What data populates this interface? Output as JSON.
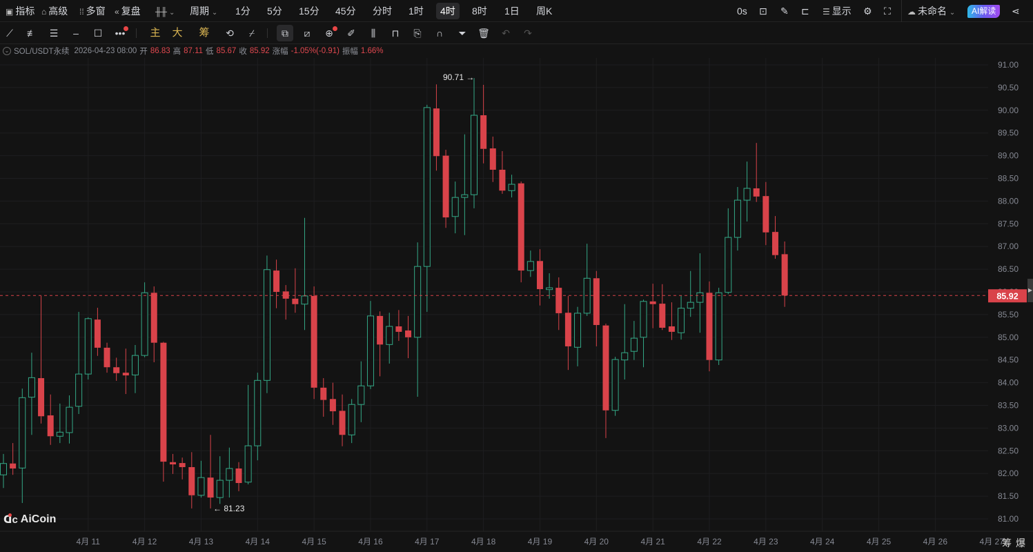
{
  "topbar": {
    "left": [
      {
        "label": "指标",
        "icon": "chart-box-icon"
      },
      {
        "label": "高级",
        "icon": "folder-icon"
      },
      {
        "label": "多窗",
        "icon": "grid-icon"
      },
      {
        "label": "复盘",
        "icon": "rewind-icon"
      }
    ],
    "chart_type_icon": "candlestick-icon",
    "period_label": "周期",
    "periods": [
      "1分",
      "5分",
      "15分",
      "45分",
      "分时",
      "1时",
      "4时",
      "8时",
      "1日",
      "周K"
    ],
    "active_period": "4时",
    "countdown": "0s",
    "display_label": "显示",
    "layout_name": "未命名",
    "ai_label": "AI解读"
  },
  "toolbar": {
    "indicator_labels": [
      "主",
      "大",
      "筹"
    ]
  },
  "info": {
    "symbol": "SOL/USDT永续",
    "datetime": "2026-04-23 08:00",
    "open_label": "开",
    "open": "86.83",
    "high_label": "高",
    "high": "87.11",
    "low_label": "低",
    "low": "85.67",
    "close_label": "收",
    "close": "85.92",
    "change_label": "涨幅",
    "change": "-1.05%(-0.91)",
    "amplitude_label": "振幅",
    "amplitude": "1.66%"
  },
  "annotations": {
    "high_marker": "90.71 →",
    "low_marker": "← 81.23",
    "last_price": "85.92"
  },
  "logo": "AiCoin",
  "bottom_right": "筹爆",
  "colors": {
    "up": "#34a987",
    "down": "#d9434a",
    "background": "#131313",
    "last_price": "#d9434a"
  },
  "chart_data": {
    "type": "candlestick",
    "symbol": "SOL/USDT永续",
    "interval": "4h",
    "ylim": [
      81.0,
      91.0
    ],
    "yticks": [
      "91.00",
      "90.50",
      "90.00",
      "89.50",
      "89.00",
      "88.50",
      "88.00",
      "87.50",
      "87.00",
      "86.50",
      "86.00",
      "85.50",
      "85.00",
      "84.50",
      "84.00",
      "83.50",
      "83.00",
      "82.50",
      "82.00",
      "81.50",
      "81.00"
    ],
    "xticks": [
      "4月 11",
      "4月 12",
      "4月 13",
      "4月 14",
      "4月 15",
      "4月 16",
      "4月 17",
      "4月 18",
      "4月 19",
      "4月 20",
      "4月 21",
      "4月 22",
      "4月 23",
      "4月 24",
      "4月 25",
      "4月 26",
      "4月 27"
    ],
    "first_xtick_candle_index": 9,
    "candles_per_day": 6,
    "last_price": 85.92,
    "candles_ohlc": [
      [
        81.97,
        82.43,
        81.68,
        82.22
      ],
      [
        82.22,
        82.67,
        81.97,
        82.11
      ],
      [
        82.12,
        83.87,
        81.35,
        83.67
      ],
      [
        83.68,
        84.66,
        82.85,
        84.11
      ],
      [
        84.1,
        85.91,
        83.1,
        83.26
      ],
      [
        83.28,
        83.74,
        82.63,
        82.82
      ],
      [
        82.82,
        83.54,
        82.67,
        82.91
      ],
      [
        82.9,
        83.72,
        82.66,
        83.46
      ],
      [
        83.48,
        85.56,
        83.31,
        84.19
      ],
      [
        84.19,
        85.44,
        84.07,
        85.41
      ],
      [
        85.39,
        85.65,
        84.59,
        84.77
      ],
      [
        84.77,
        84.88,
        84.22,
        84.34
      ],
      [
        84.34,
        84.55,
        84.04,
        84.21
      ],
      [
        84.22,
        84.75,
        83.75,
        84.16
      ],
      [
        84.17,
        84.83,
        83.77,
        84.6
      ],
      [
        84.6,
        86.21,
        84.56,
        85.98
      ],
      [
        85.98,
        86.12,
        84.45,
        84.88
      ],
      [
        84.88,
        84.9,
        81.82,
        82.26
      ],
      [
        82.25,
        82.43,
        81.99,
        82.2
      ],
      [
        82.23,
        82.35,
        81.87,
        82.14
      ],
      [
        82.14,
        82.47,
        81.23,
        81.52
      ],
      [
        81.52,
        82.28,
        81.47,
        81.91
      ],
      [
        81.91,
        82.85,
        81.23,
        81.47
      ],
      [
        81.47,
        82.38,
        81.33,
        81.85
      ],
      [
        81.85,
        82.57,
        81.47,
        82.11
      ],
      [
        82.11,
        82.25,
        81.61,
        81.79
      ],
      [
        81.81,
        83.95,
        81.76,
        82.61
      ],
      [
        82.61,
        84.22,
        82.29,
        84.05
      ],
      [
        84.05,
        86.8,
        83.77,
        86.49
      ],
      [
        86.47,
        86.71,
        85.64,
        86.0
      ],
      [
        86.01,
        86.15,
        85.39,
        85.85
      ],
      [
        85.85,
        86.52,
        85.54,
        85.73
      ],
      [
        85.73,
        87.63,
        85.16,
        85.91
      ],
      [
        85.91,
        86.12,
        83.64,
        83.89
      ],
      [
        83.89,
        84.1,
        83.25,
        83.62
      ],
      [
        83.64,
        84.0,
        83.07,
        83.37
      ],
      [
        83.38,
        83.74,
        82.6,
        82.85
      ],
      [
        82.85,
        83.64,
        82.67,
        83.52
      ],
      [
        83.52,
        84.47,
        83.13,
        83.93
      ],
      [
        83.93,
        85.8,
        83.86,
        85.47
      ],
      [
        85.47,
        85.57,
        84.14,
        84.84
      ],
      [
        84.84,
        85.54,
        84.42,
        85.24
      ],
      [
        85.24,
        85.6,
        84.92,
        85.12
      ],
      [
        85.15,
        85.47,
        84.54,
        85.0
      ],
      [
        85.0,
        87.09,
        83.69,
        86.56
      ],
      [
        86.56,
        90.12,
        85.56,
        90.06
      ],
      [
        90.04,
        90.57,
        88.67,
        88.99
      ],
      [
        89.0,
        89.13,
        87.41,
        87.64
      ],
      [
        87.66,
        88.43,
        87.29,
        88.08
      ],
      [
        88.08,
        89.47,
        87.25,
        88.14
      ],
      [
        88.14,
        90.71,
        87.84,
        89.89
      ],
      [
        89.89,
        90.56,
        88.83,
        89.15
      ],
      [
        89.16,
        89.42,
        88.42,
        88.69
      ],
      [
        88.69,
        89.1,
        88.16,
        88.23
      ],
      [
        88.23,
        88.58,
        88.08,
        88.37
      ],
      [
        88.39,
        88.43,
        86.21,
        86.47
      ],
      [
        86.47,
        86.91,
        86.33,
        86.67
      ],
      [
        86.68,
        86.94,
        85.7,
        86.06
      ],
      [
        86.05,
        86.41,
        85.85,
        86.09
      ],
      [
        86.09,
        86.32,
        85.16,
        85.53
      ],
      [
        85.54,
        85.91,
        84.28,
        84.8
      ],
      [
        84.78,
        85.67,
        84.36,
        85.53
      ],
      [
        85.53,
        87.06,
        85.47,
        86.3
      ],
      [
        86.3,
        86.46,
        84.8,
        85.27
      ],
      [
        85.26,
        85.3,
        82.78,
        83.39
      ],
      [
        83.39,
        84.57,
        83.27,
        84.51
      ],
      [
        84.5,
        85.73,
        84.07,
        84.66
      ],
      [
        84.69,
        85.36,
        84.5,
        84.98
      ],
      [
        85.0,
        85.83,
        84.34,
        85.79
      ],
      [
        85.79,
        86.18,
        85.2,
        85.73
      ],
      [
        85.74,
        86.17,
        85.16,
        85.21
      ],
      [
        85.24,
        85.77,
        84.94,
        85.12
      ],
      [
        85.1,
        85.92,
        84.95,
        85.64
      ],
      [
        85.64,
        86.46,
        85.45,
        85.77
      ],
      [
        85.77,
        86.85,
        85.1,
        85.98
      ],
      [
        85.98,
        86.23,
        84.25,
        84.5
      ],
      [
        84.5,
        86.09,
        84.39,
        85.98
      ],
      [
        85.99,
        87.84,
        85.95,
        87.2
      ],
      [
        87.2,
        88.31,
        86.91,
        88.02
      ],
      [
        88.02,
        88.87,
        87.55,
        88.28
      ],
      [
        88.28,
        89.28,
        87.98,
        88.1
      ],
      [
        88.11,
        88.42,
        87.03,
        87.31
      ],
      [
        87.32,
        87.67,
        86.73,
        86.81
      ],
      [
        86.83,
        87.11,
        85.67,
        85.92
      ]
    ]
  }
}
